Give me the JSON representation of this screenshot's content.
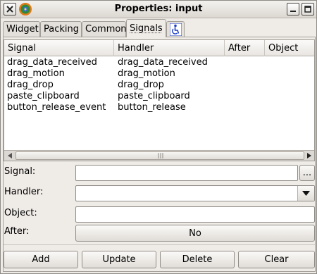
{
  "window": {
    "title": "Properties: input"
  },
  "tabs": [
    {
      "label": "Widget"
    },
    {
      "label": "Packing"
    },
    {
      "label": "Common"
    },
    {
      "label": "Signals"
    },
    {
      "label": "",
      "icon": "accessibility-icon"
    }
  ],
  "columns": {
    "signal": "Signal",
    "handler": "Handler",
    "after": "After",
    "object": "Object"
  },
  "rows": [
    {
      "signal": "drag_data_received",
      "handler": "drag_data_received",
      "after": "",
      "object": ""
    },
    {
      "signal": "drag_motion",
      "handler": "drag_motion",
      "after": "",
      "object": ""
    },
    {
      "signal": "drag_drop",
      "handler": "drag_drop",
      "after": "",
      "object": ""
    },
    {
      "signal": "paste_clipboard",
      "handler": "paste_clipboard",
      "after": "",
      "object": ""
    },
    {
      "signal": "button_release_event",
      "handler": "button_release",
      "after": "",
      "object": ""
    }
  ],
  "form": {
    "signal_label": "Signal:",
    "signal_value": "",
    "browse_label": "...",
    "handler_label": "Handler:",
    "handler_value": "",
    "object_label": "Object:",
    "object_value": "",
    "after_label": "After:",
    "after_toggle": "No"
  },
  "buttons": {
    "add": "Add",
    "update": "Update",
    "delete": "Delete",
    "clear": "Clear"
  },
  "colors": {
    "window_bg": "#efebe7",
    "list_bg": "#ffffff",
    "title_bar": "#dcd8d2"
  }
}
